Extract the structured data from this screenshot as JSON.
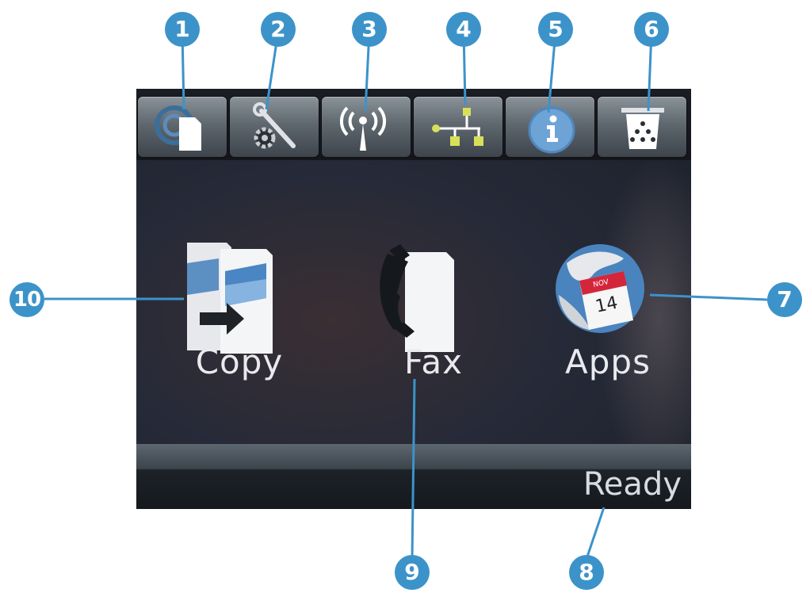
{
  "main": {
    "apps": [
      {
        "id": "copy",
        "label": "Copy"
      },
      {
        "id": "fax",
        "label": "Fax"
      },
      {
        "id": "apps",
        "label": "Apps"
      }
    ]
  },
  "status": {
    "text": "Ready"
  },
  "calendar_icon": {
    "month": "NOV",
    "day": "14"
  },
  "callouts": [
    "1",
    "2",
    "3",
    "4",
    "5",
    "6",
    "7",
    "8",
    "9",
    "10"
  ],
  "colors": {
    "accent": "#3c93c9",
    "screen": "#262a38",
    "button": "#6a7279"
  },
  "toolbar_icons": [
    "web-services-icon",
    "setup-wrench-gear-icon",
    "wireless-icon",
    "network-icon",
    "information-icon",
    "supplies-toner-icon"
  ]
}
